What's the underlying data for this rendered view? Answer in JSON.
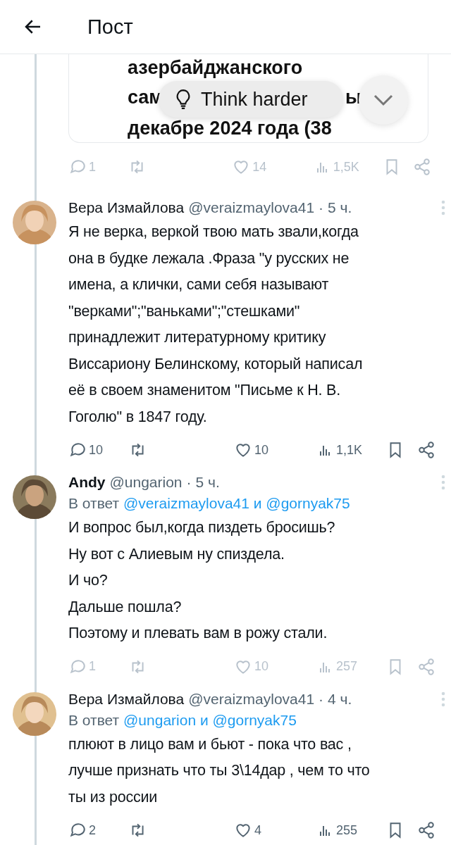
{
  "header": {
    "title": "Пост"
  },
  "quoted_card": {
    "lines": [
      "азербайджанского",
      "сам",
      "ы",
      "декабре 2024 года (38"
    ]
  },
  "overlay": {
    "label": "Think harder"
  },
  "top_actions": {
    "dimmed": true,
    "replies": "1",
    "likes": "14",
    "views": "1,5K"
  },
  "posts": [
    {
      "author": {
        "name": "Вера Измайлова",
        "handle": "@veraizmaylova41",
        "bold": false
      },
      "separator": "·",
      "time": "5 ч.",
      "text": "Я не верка, веркой твою мать звали,когда\nона в будке лежала .Фраза \"у русских не\nимена, а клички, сами себя называют\n\"верками\";\"ваньками\";\"стешками\"\nпринадлежит литературному критику\nВиссариону Белинскому, который написал\nеё в своем знаменитом \"Письме к Н. В.\nГоголю\" в 1847 году.",
      "actions": {
        "dimmed": false,
        "replies": "10",
        "likes": "10",
        "views": "1,1K"
      }
    },
    {
      "author": {
        "name": "Andy",
        "handle": "@ungarion",
        "bold": true
      },
      "separator": "·",
      "time": "5 ч.",
      "reply": {
        "prefix": "В ответ",
        "mentions": [
          "@veraizmaylova41",
          "@gornyak75"
        ],
        "joiner": "и"
      },
      "text": "И вопрос был,когда пиздеть бросишь?\nНу вот с Алиевым ну спиздела.\nИ чо?\nДальше пошла?\nПоэтому и плевать вам в рожу стали.",
      "actions": {
        "dimmed": true,
        "replies": "1",
        "likes": "10",
        "views": "257"
      }
    },
    {
      "author": {
        "name": "Вера Измайлова",
        "handle": "@veraizmaylova41",
        "bold": false
      },
      "separator": "·",
      "time": "4 ч.",
      "reply": {
        "prefix": "В ответ",
        "mentions": [
          "@ungarion",
          "@gornyak75"
        ],
        "joiner": "и"
      },
      "text": "плюют в лицо вам  и бьют - пока что вас ,\nлучше признать что ты 3\\14дар , чем то что\nты из россии",
      "actions": {
        "dimmed": false,
        "replies": "2",
        "likes": "4",
        "views": "255"
      }
    }
  ]
}
